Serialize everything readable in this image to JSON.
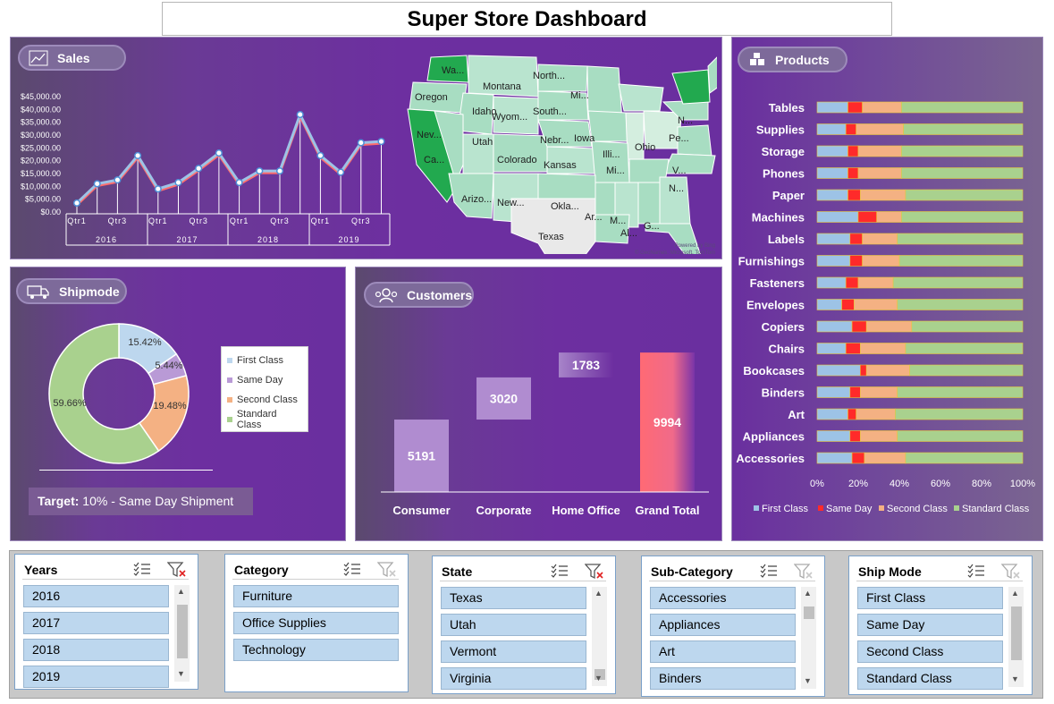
{
  "title": "Super Store Dashboard",
  "sales": {
    "label": "Sales",
    "chart_data": {
      "type": "line",
      "y_tick_labels": [
        "$45,000.00",
        "$40,000.00",
        "$35,000.00",
        "$30,000.00",
        "$25,000.00",
        "$20,000.00",
        "$15,000.00",
        "$10,000.00",
        "$5,000.00",
        "$0.00"
      ],
      "ylim": [
        0,
        45000
      ],
      "quarter_labels": [
        "Qtr1",
        "Qtr3",
        "Qtr1",
        "Qtr3",
        "Qtr1",
        "Qtr3",
        "Qtr1",
        "Qtr3"
      ],
      "years": [
        "2016",
        "2017",
        "2018",
        "2019"
      ],
      "values": [
        3500,
        11000,
        12500,
        22000,
        9000,
        11500,
        17000,
        23000,
        11500,
        16000,
        16000,
        38000,
        22000,
        15500,
        27000,
        27500
      ]
    }
  },
  "map": {
    "state_labels": [
      "Wa...",
      "Oregon",
      "Montana",
      "North...",
      "Mi...",
      "Idaho",
      "Wyom...",
      "South...",
      "Nev...",
      "Utah",
      "Nebr...",
      "Iowa",
      "Ca...",
      "Colorado",
      "Kansas",
      "Illi...",
      "Mi...",
      "Ohio",
      "Pe...",
      "N...",
      "V...",
      "N...",
      "Arizo...",
      "New...",
      "Okla...",
      "Ar...",
      "M...",
      "Al...",
      "G...",
      "Texas"
    ],
    "attribution": "Powered by Bing\n© GeoNames, Microsoft, TomTom"
  },
  "shipmode": {
    "label": "Shipmode",
    "chart_data": {
      "type": "pie",
      "labels": [
        "First Class",
        "Same Day",
        "Second Class",
        "Standard Class"
      ],
      "values": [
        15.42,
        5.44,
        19.48,
        59.66
      ],
      "value_labels": [
        "15.42%",
        "5.44%",
        "19.48%",
        "59.66%"
      ],
      "colors": [
        "#bdd7ee",
        "#b99ad6",
        "#f4b183",
        "#a9d18e"
      ]
    },
    "target_label": "Target:",
    "target_text": " 10% - Same Day Shipment"
  },
  "customers": {
    "label": "Customers",
    "chart_data": {
      "type": "bar",
      "categories": [
        "Consumer",
        "Corporate",
        "Home Office",
        "Grand Total"
      ],
      "values": [
        5191,
        3020,
        1783,
        9994
      ],
      "ylim": [
        0,
        10500
      ]
    }
  },
  "products": {
    "label": "Products",
    "chart_data": {
      "type": "bar",
      "stacked": "100%",
      "categories": [
        "Tables",
        "Supplies",
        "Storage",
        "Phones",
        "Paper",
        "Machines",
        "Labels",
        "Furnishings",
        "Fasteners",
        "Envelopes",
        "Copiers",
        "Chairs",
        "Bookcases",
        "Binders",
        "Art",
        "Appliances",
        "Accessories"
      ],
      "series": [
        {
          "name": "First Class",
          "values": [
            15,
            14,
            15,
            15,
            15,
            20,
            16,
            16,
            14,
            12,
            17,
            14,
            21,
            16,
            15,
            16,
            17
          ]
        },
        {
          "name": "Same Day",
          "values": [
            7,
            5,
            5,
            5,
            6,
            9,
            6,
            6,
            6,
            6,
            7,
            7,
            3,
            5,
            4,
            5,
            6
          ]
        },
        {
          "name": "Second Class",
          "values": [
            19,
            23,
            21,
            21,
            22,
            12,
            17,
            18,
            17,
            21,
            22,
            22,
            21,
            18,
            19,
            18,
            20
          ]
        },
        {
          "name": "Standard Class",
          "values": [
            59,
            58,
            59,
            59,
            57,
            59,
            61,
            60,
            63,
            61,
            54,
            57,
            55,
            61,
            62,
            61,
            57
          ]
        }
      ],
      "x_tick_labels": [
        "0%",
        "20%",
        "40%",
        "60%",
        "80%",
        "100%"
      ],
      "colors": [
        "#9dc3e6",
        "#ff2a2a",
        "#f4b183",
        "#a9d18e"
      ],
      "legend_position": "bottom"
    }
  },
  "slicers": [
    {
      "title": "Years",
      "items": [
        "2016",
        "2017",
        "2018",
        "2019"
      ]
    },
    {
      "title": "Category",
      "items": [
        "Furniture",
        "Office Supplies",
        "Technology"
      ]
    },
    {
      "title": "State",
      "items": [
        "Texas",
        "Utah",
        "Vermont",
        "Virginia"
      ]
    },
    {
      "title": "Sub-Category",
      "items": [
        "Accessories",
        "Appliances",
        "Art",
        "Binders"
      ]
    },
    {
      "title": "Ship Mode",
      "items": [
        "First Class",
        "Same Day",
        "Second Class",
        "Standard Class"
      ]
    }
  ]
}
